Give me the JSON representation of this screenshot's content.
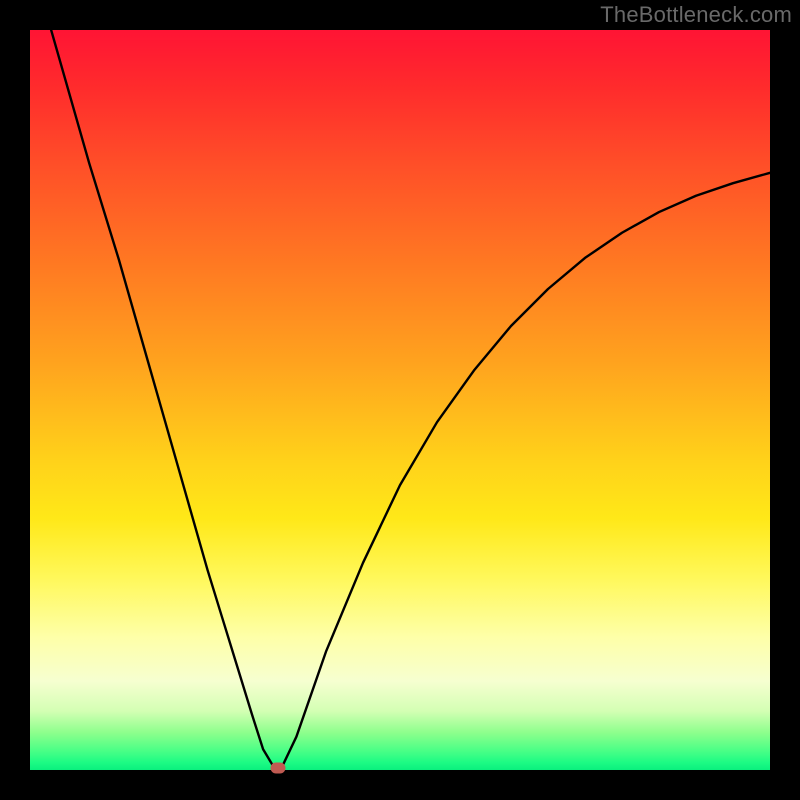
{
  "watermark": "TheBottleneck.com",
  "chart_data": {
    "type": "line",
    "title": "",
    "xlabel": "",
    "ylabel": "",
    "xlim": [
      0,
      100
    ],
    "ylim": [
      0,
      100
    ],
    "grid": false,
    "legend": false,
    "series": [
      {
        "name": "bottleneck-curve",
        "x": [
          0,
          4,
          8,
          12,
          16,
          20,
          24,
          26,
          28,
          30,
          31.5,
          33,
          34,
          36,
          40,
          45,
          50,
          55,
          60,
          65,
          70,
          75,
          80,
          85,
          90,
          95,
          100
        ],
        "y": [
          110,
          96,
          82,
          69,
          55,
          41,
          27,
          20.5,
          14,
          7.5,
          2.8,
          0.3,
          0.3,
          4.5,
          16,
          28,
          38.5,
          47,
          54,
          60,
          65,
          69.2,
          72.6,
          75.4,
          77.6,
          79.3,
          80.7
        ]
      }
    ],
    "minimum_marker": {
      "x": 33.5,
      "y": 0.3
    },
    "background_gradient": {
      "top": "#ff1434",
      "mid": "#ffe818",
      "bottom": "#0af07e"
    }
  }
}
